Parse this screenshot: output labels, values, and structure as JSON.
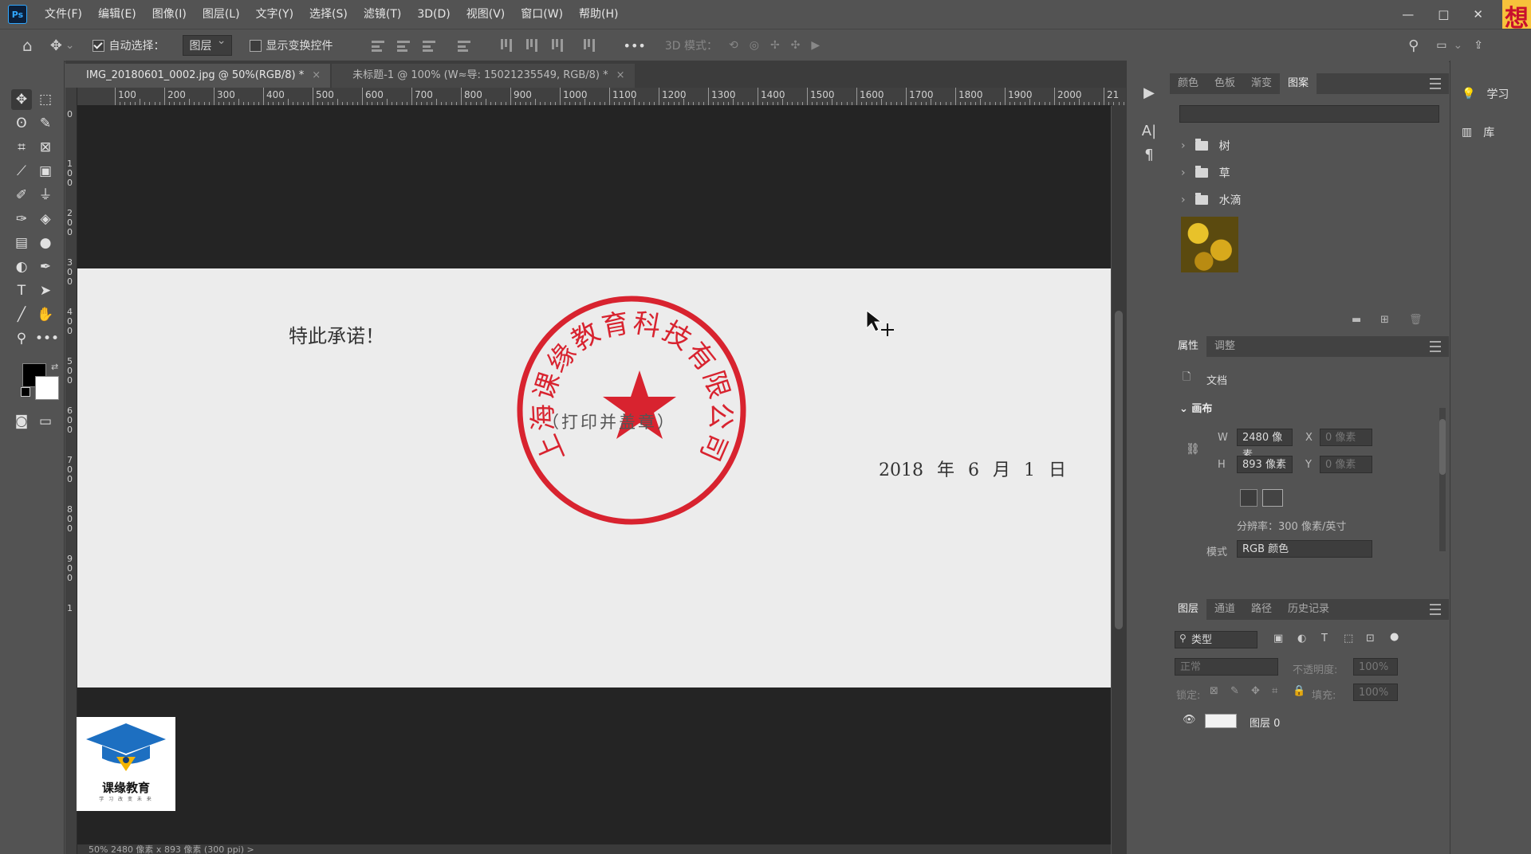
{
  "app": {
    "logo": "Ps"
  },
  "menu": [
    "文件(F)",
    "编辑(E)",
    "图像(I)",
    "图层(L)",
    "文字(Y)",
    "选择(S)",
    "滤镜(T)",
    "3D(D)",
    "视图(V)",
    "窗口(W)",
    "帮助(H)"
  ],
  "window_controls": {
    "minimize": "—",
    "restore": "□",
    "close": "✕"
  },
  "corner_char": "想",
  "options": {
    "auto_select_label": "自动选择：",
    "auto_select_checked": true,
    "auto_select_target": "图层",
    "show_transform_label": "显示变换控件",
    "more": "•••",
    "mode3d_label": "3D 模式："
  },
  "tabs": [
    {
      "label": "IMG_20180601_0002.jpg @ 50%(RGB/8) *",
      "active": true,
      "close": "×"
    },
    {
      "label": "未标题-1 @ 100% (W≈导: 15021235549, RGB/8) *",
      "active": false,
      "close": "×"
    }
  ],
  "ruler_h": [
    "100",
    "200",
    "300",
    "400",
    "500",
    "600",
    "700",
    "800",
    "900",
    "1000",
    "1100",
    "1200",
    "1300",
    "1400",
    "1500",
    "1600",
    "1700",
    "1800",
    "1900",
    "2000",
    "21"
  ],
  "ruler_v": [
    "0",
    "1 0 0",
    "2 0 0",
    "3 0 0",
    "4 0 0",
    "5 0 0",
    "6 0 0",
    "7 0 0",
    "8 0 0",
    "9 0 0",
    "1"
  ],
  "document": {
    "promise_text": "特此承诺！",
    "seal_company": "上海课缘教育科技有限公司",
    "seal_caption": "（打印并盖章）",
    "date": "2018 年  6 月  1 日"
  },
  "brand": {
    "name": "课缘教育",
    "sub": "学 习 改 变 未 来"
  },
  "status": {
    "text": "50%     2480 像素 x 893 像素 (300 ppi)   >"
  },
  "swatch_panel": {
    "tabs": [
      "颜色",
      "色板",
      "渐变",
      "图案"
    ],
    "active_tab": "图案",
    "groups": [
      "树",
      "草",
      "水滴"
    ]
  },
  "properties_panel": {
    "tabs": [
      "属性",
      "调整"
    ],
    "doc_label": "文档",
    "section": "画布",
    "w_label": "W",
    "w_value": "2480 像素",
    "h_label": "H",
    "h_value": "893 像素",
    "x_label": "X",
    "x_value": "0 像素",
    "y_label": "Y",
    "y_value": "0 像素",
    "resolution": "分辨率：300 像素/英寸",
    "mode_label": "模式",
    "mode_value": "RGB 颜色"
  },
  "layers_panel": {
    "tabs": [
      "图层",
      "通道",
      "路径",
      "历史记录"
    ],
    "filter": "类型",
    "blend": "正常",
    "opacity_label": "不透明度:",
    "opacity_value": "100%",
    "lock_label": "锁定:",
    "fill_label": "填充:",
    "fill_value": "100%",
    "layer_name": "图层 0"
  },
  "far_right": {
    "learn": "学习",
    "library": "库"
  },
  "colors": {
    "seal_red": "#d8232f",
    "ps_blue": "#31a8ff",
    "panel_bg": "#535353",
    "canvas_bg": "#242424"
  }
}
